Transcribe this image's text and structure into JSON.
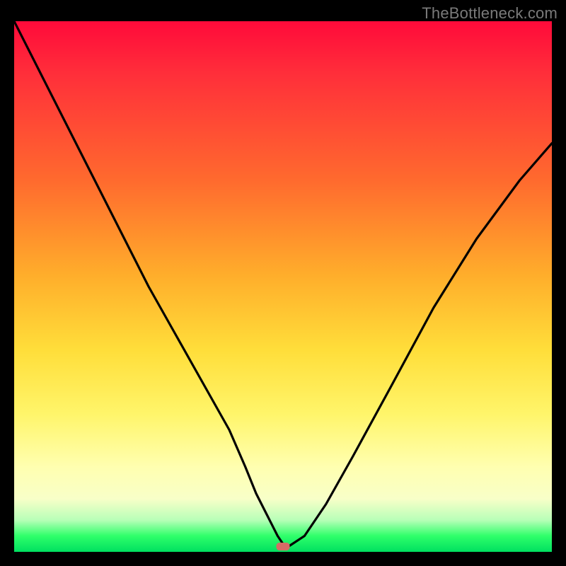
{
  "watermark": "TheBottleneck.com",
  "chart_data": {
    "type": "line",
    "title": "",
    "xlabel": "",
    "ylabel": "",
    "xlim": [
      0,
      100
    ],
    "ylim": [
      0,
      100
    ],
    "grid": false,
    "series": [
      {
        "name": "bottleneck-curve",
        "x": [
          0,
          5,
          10,
          15,
          20,
          25,
          30,
          35,
          40,
          43,
          45,
          47,
          49,
          50,
          51,
          54,
          58,
          63,
          70,
          78,
          86,
          94,
          100
        ],
        "values": [
          100,
          90,
          80,
          70,
          60,
          50,
          41,
          32,
          23,
          16,
          11,
          7,
          3,
          1.5,
          1,
          3,
          9,
          18,
          31,
          46,
          59,
          70,
          77
        ]
      }
    ],
    "optimum_marker": {
      "x": 50,
      "y": 1
    },
    "background_gradient": {
      "stops": [
        {
          "pos": 0,
          "color": "#ff0a3a"
        },
        {
          "pos": 10,
          "color": "#ff2f3a"
        },
        {
          "pos": 30,
          "color": "#ff6a2e"
        },
        {
          "pos": 48,
          "color": "#ffae2b"
        },
        {
          "pos": 62,
          "color": "#ffde3a"
        },
        {
          "pos": 74,
          "color": "#fff56a"
        },
        {
          "pos": 84,
          "color": "#ffffb0"
        },
        {
          "pos": 90,
          "color": "#f8ffc8"
        },
        {
          "pos": 94,
          "color": "#b8ffb8"
        },
        {
          "pos": 97,
          "color": "#2fff6a"
        },
        {
          "pos": 100,
          "color": "#00e060"
        }
      ]
    }
  }
}
